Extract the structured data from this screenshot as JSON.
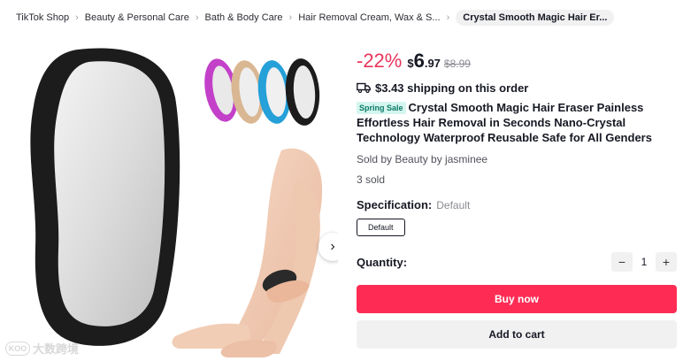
{
  "breadcrumb": {
    "items": [
      "TikTok Shop",
      "Beauty & Personal Care",
      "Bath & Body Care",
      "Hair Removal Cream, Wax & S..."
    ],
    "current": "Crystal Smooth Magic Hair Er..."
  },
  "gallery": {
    "next_icon": "chevron-right-icon",
    "watermark_text": "大数跨境",
    "watermark_logo": "KOO"
  },
  "price": {
    "discount": "-22%",
    "currency": "$",
    "integer": "6",
    "decimal": ".97",
    "original": "$8.99"
  },
  "shipping": {
    "icon": "truck-icon",
    "text": "$3.43 shipping on this order"
  },
  "product": {
    "badge": "Spring Sale",
    "title": "Crystal Smooth Magic Hair Eraser Painless Effortless Hair Removal in Seconds Nano-Crystal Technology Waterproof Reusable Safe for All Genders",
    "sold_by": "Sold by Beauty by jasminee",
    "sold_count": "3 sold"
  },
  "specification": {
    "label": "Specification:",
    "value": "Default",
    "options": [
      "Default"
    ]
  },
  "quantity": {
    "label": "Quantity:",
    "value": "1",
    "minus": "−",
    "plus": "+"
  },
  "actions": {
    "buy_now": "Buy now",
    "add_to_cart": "Add to cart"
  },
  "colors": {
    "accent": "#fe2c55",
    "discount": "#e8355c",
    "badge_bg": "#d5f5ef",
    "badge_text": "#0b7a66"
  }
}
